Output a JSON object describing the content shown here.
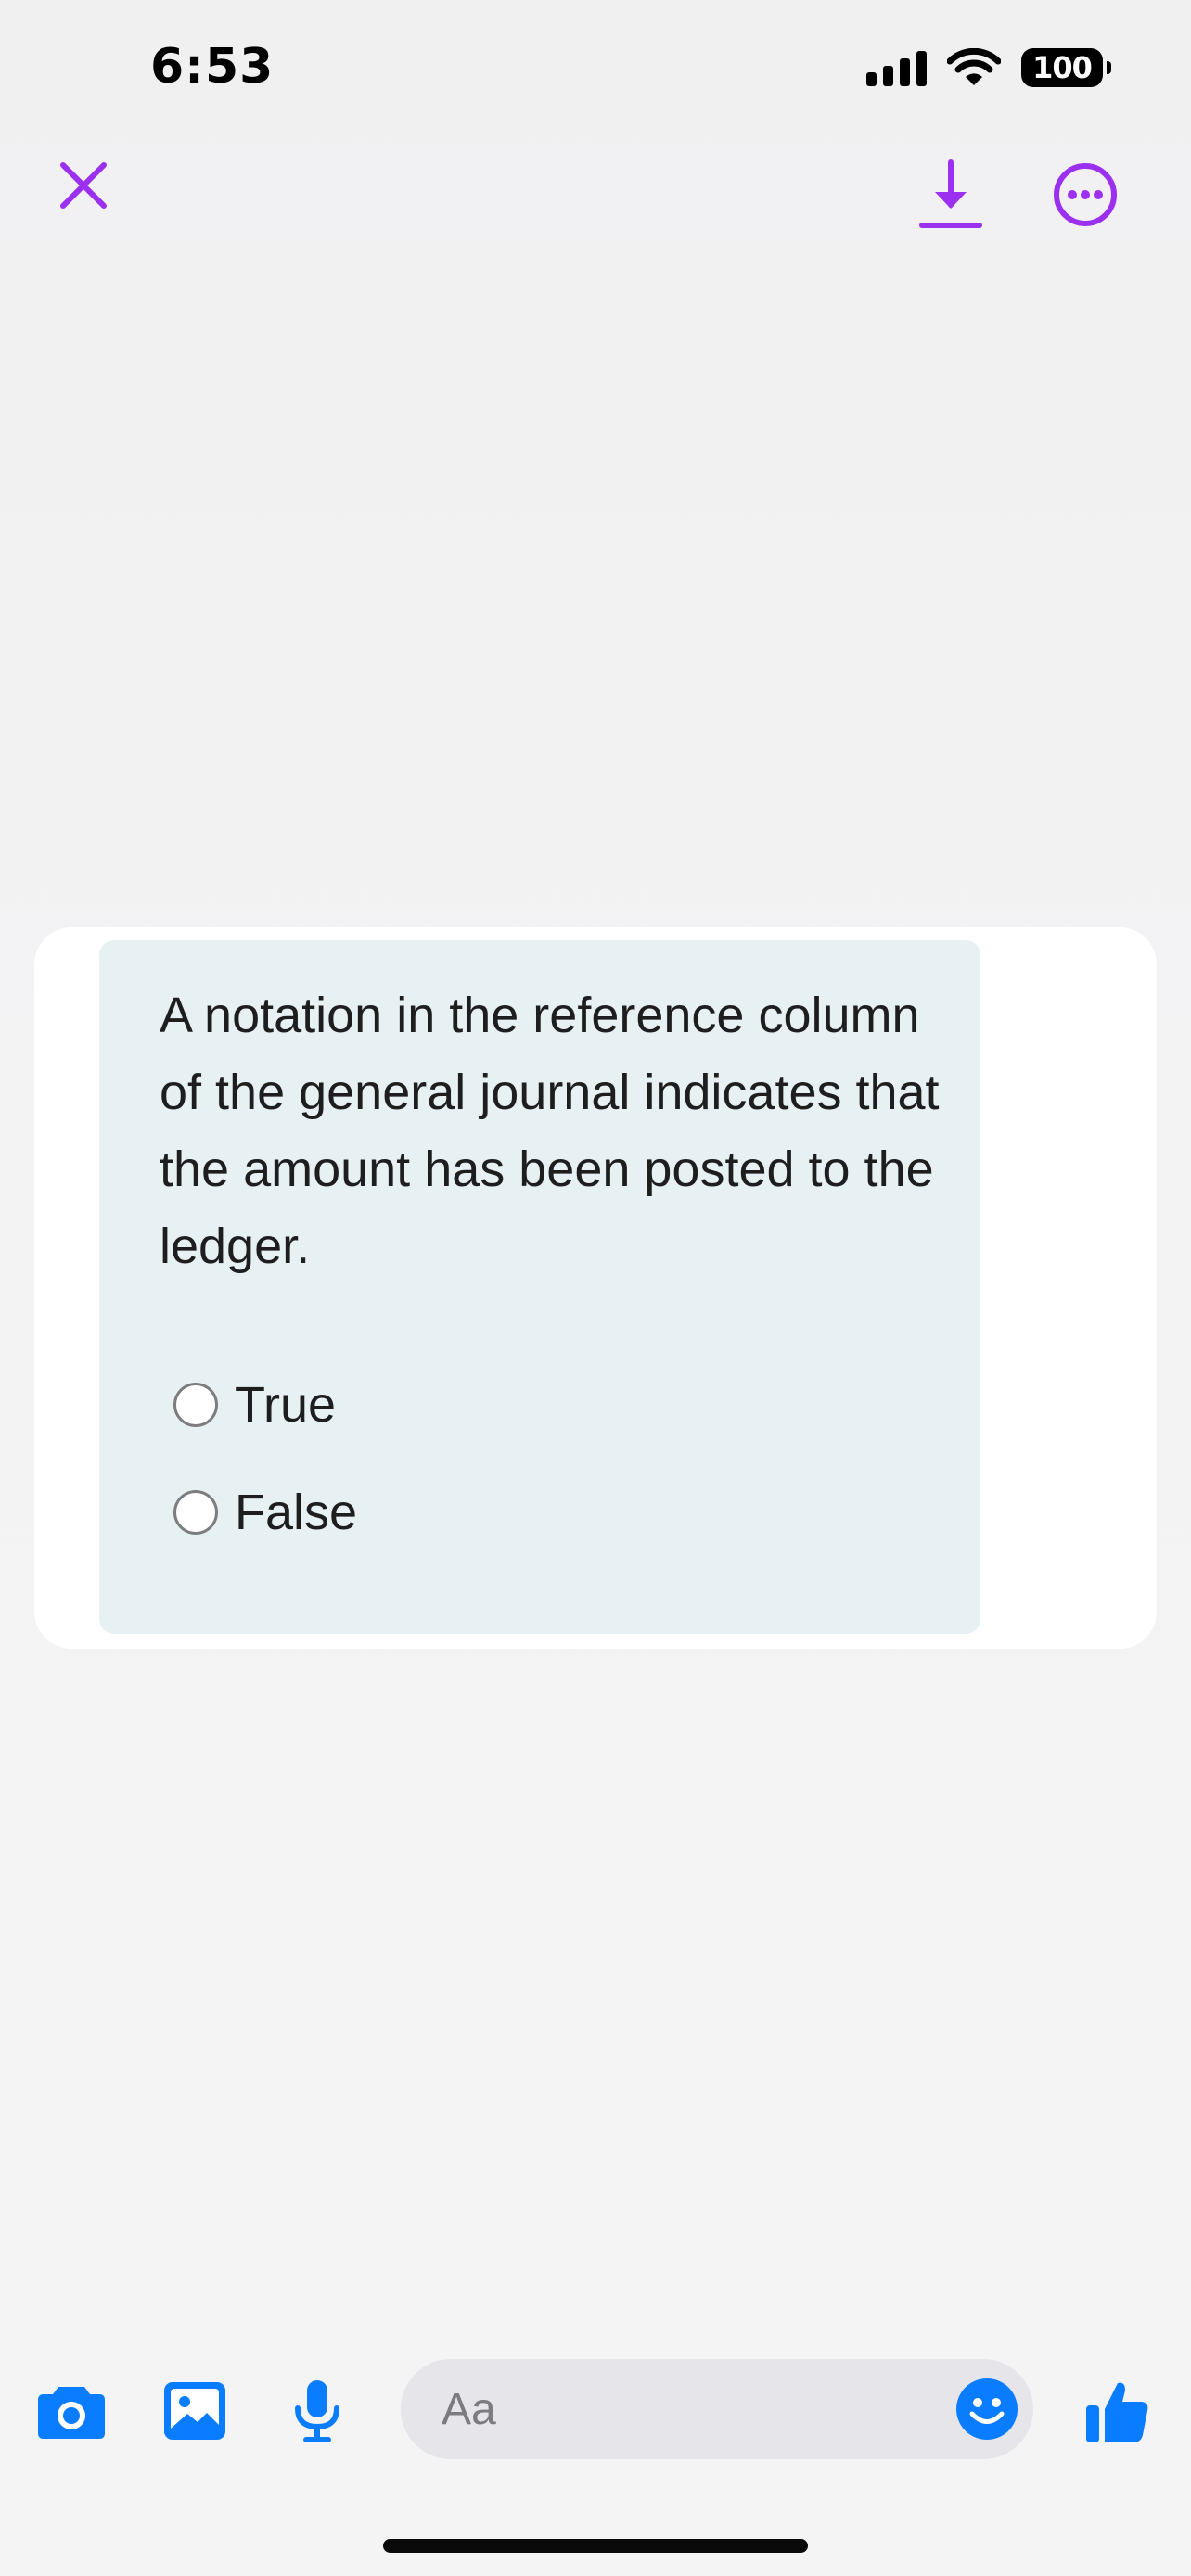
{
  "status_bar": {
    "time": "6:53",
    "battery": "100"
  },
  "top_bar": {
    "close_icon": "close-x-icon",
    "download_icon": "download-icon",
    "more_icon": "more-options-icon",
    "accent_color": "#9b30f0"
  },
  "image": {
    "question": "A notation in the reference column of the general journal indicates that the amount has been posted to the ledger.",
    "options": [
      "True",
      "False"
    ]
  },
  "composer": {
    "placeholder": "Aa",
    "camera_icon": "camera-icon",
    "gallery_icon": "gallery-icon",
    "mic_icon": "microphone-icon",
    "emoji_icon": "emoji-icon",
    "like_icon": "thumbs-up-icon",
    "accent_color": "#0a7cff"
  }
}
